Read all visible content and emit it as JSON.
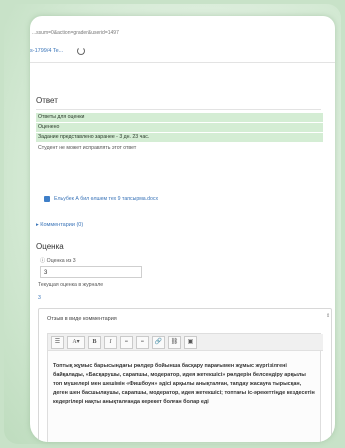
{
  "browser": {
    "url": "...ssum=0&action=grader&userid=1497",
    "tab_label": "s-1799/4 Te..."
  },
  "submission": {
    "heading": "Ответ",
    "status_rows": [
      "Ответы для оценки",
      "Оценено",
      "Задание представлено заранее - 3 дн. 23 час."
    ],
    "note": "Студент не может исправлять этот ответ",
    "file_name": "Ельубек А бил өлшем тех 9 тапсырма.docx",
    "comments_link": "Комментарии (0)"
  },
  "grading": {
    "heading": "Оценка",
    "grade_label": "Оценка из 3",
    "grade_value": "3",
    "gradebook_label": "Текущая оценка в журнале",
    "gradebook_value": "3"
  },
  "feedback": {
    "header": "Отзыв в виде комментария",
    "toolbar": [
      "☰",
      "A▾",
      "B",
      "I",
      "≡",
      "≡",
      "🔗",
      "⛓",
      "▣"
    ],
    "text": "Топтық жұмыс барысындағы рөлдер бойынша басқару парағымен жұмыс жүргізілгені байқалады, «Басқарушы, сарапшы, модератор, идея жетекшісі» рөлдерін белсендіру арқылы топ мүшелері мен шешімін «Фишбоун» әдісі арқылы анықталған, тапдау жасауға тырысқан, деген шен басшылаушы, сарапшы, модератор, идея жетекшісі; топтағы іс-әрекеттіңде кездесетін кедергілері нақты анықталғанда керекет болған болар еді"
  }
}
